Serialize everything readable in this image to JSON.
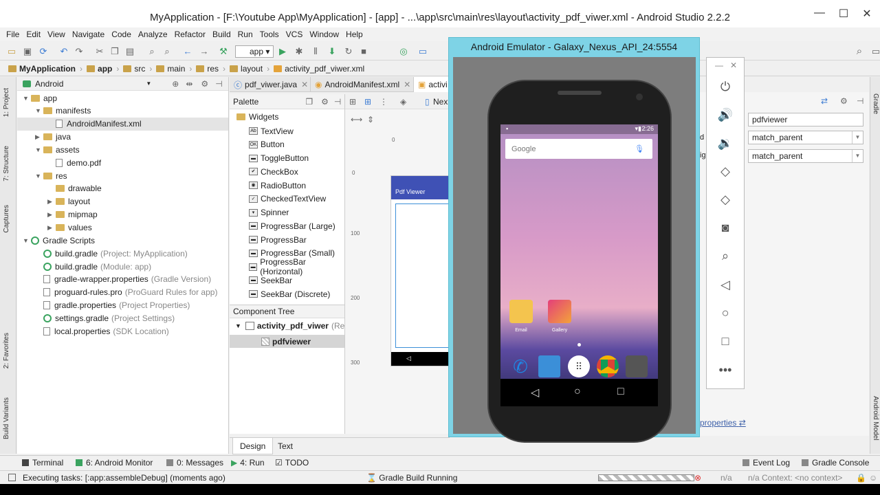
{
  "window": {
    "title": "MyApplication - [F:\\Youtube App\\MyApplication] - [app] - ...\\app\\src\\main\\res\\layout\\activity_pdf_viwer.xml - Android Studio 2.2.2",
    "min": "—",
    "max": "☐",
    "close": "✕"
  },
  "menu": [
    "File",
    "Edit",
    "View",
    "Navigate",
    "Code",
    "Analyze",
    "Refactor",
    "Build",
    "Run",
    "Tools",
    "VCS",
    "Window",
    "Help"
  ],
  "toolbar": {
    "run_config": "app"
  },
  "breadcrumbs": [
    "MyApplication",
    "app",
    "src",
    "main",
    "res",
    "layout",
    "activity_pdf_viwer.xml"
  ],
  "left_tabs": [
    "1: Project",
    "7: Structure",
    "Captures",
    "2: Favorites",
    "Build Variants"
  ],
  "project": {
    "view": "Android",
    "tree": [
      {
        "label": "app",
        "indent": 0,
        "type": "folder",
        "arrow": "▼"
      },
      {
        "label": "manifests",
        "indent": 1,
        "type": "folder",
        "arrow": "▼"
      },
      {
        "label": "AndroidManifest.xml",
        "indent": 2,
        "type": "file",
        "arrow": ""
      },
      {
        "label": "java",
        "indent": 1,
        "type": "folder",
        "arrow": "▶"
      },
      {
        "label": "assets",
        "indent": 1,
        "type": "folder",
        "arrow": "▼"
      },
      {
        "label": "demo.pdf",
        "indent": 2,
        "type": "file",
        "arrow": ""
      },
      {
        "label": "res",
        "indent": 1,
        "type": "folder",
        "arrow": "▼"
      },
      {
        "label": "drawable",
        "indent": 2,
        "type": "folder",
        "arrow": ""
      },
      {
        "label": "layout",
        "indent": 2,
        "type": "folder",
        "arrow": "▶"
      },
      {
        "label": "mipmap",
        "indent": 2,
        "type": "folder",
        "arrow": "▶"
      },
      {
        "label": "values",
        "indent": 2,
        "type": "folder",
        "arrow": "▶"
      },
      {
        "label": "Gradle Scripts",
        "indent": 0,
        "type": "gradle",
        "arrow": "▼"
      },
      {
        "label": "build.gradle",
        "note": "(Project: MyApplication)",
        "indent": 1,
        "type": "gradle",
        "arrow": ""
      },
      {
        "label": "build.gradle",
        "note": "(Module: app)",
        "indent": 1,
        "type": "gradle",
        "arrow": ""
      },
      {
        "label": "gradle-wrapper.properties",
        "note": "(Gradle Version)",
        "indent": 1,
        "type": "file",
        "arrow": ""
      },
      {
        "label": "proguard-rules.pro",
        "note": "(ProGuard Rules for app)",
        "indent": 1,
        "type": "file",
        "arrow": ""
      },
      {
        "label": "gradle.properties",
        "note": "(Project Properties)",
        "indent": 1,
        "type": "file",
        "arrow": ""
      },
      {
        "label": "settings.gradle",
        "note": "(Project Settings)",
        "indent": 1,
        "type": "gradle",
        "arrow": ""
      },
      {
        "label": "local.properties",
        "note": "(SDK Location)",
        "indent": 1,
        "type": "file",
        "arrow": ""
      }
    ]
  },
  "editor_tabs": [
    "pdf_viwer.java",
    "AndroidManifest.xml",
    "activi"
  ],
  "palette": {
    "title": "Palette",
    "group": "Widgets",
    "items": [
      "TextView",
      "Button",
      "ToggleButton",
      "CheckBox",
      "RadioButton",
      "CheckedTextView",
      "Spinner",
      "ProgressBar (Large)",
      "ProgressBar",
      "ProgressBar (Small)",
      "ProgressBar (Horizontal)",
      "SeekBar",
      "SeekBar (Discrete)"
    ],
    "component_tree_title": "Component Tree",
    "root": "activity_pdf_viwer",
    "root_note": "(Rela",
    "child": "pdfviewer"
  },
  "design": {
    "device": "Nex",
    "ruler": [
      "0",
      "0",
      "100",
      "200",
      "300"
    ],
    "preview_title": "Pdf Viewer"
  },
  "design_tabs": [
    "Design",
    "Text"
  ],
  "emulator": {
    "title": "Android Emulator - Galaxy_Nexus_API_24:5554",
    "time": "2:26",
    "search": "Google",
    "apps": [
      "Email",
      "Gallery"
    ]
  },
  "properties": {
    "id": "pdfviewer",
    "width": "match_parent",
    "height": "match_parent",
    "link": "properties",
    "clip": [
      "d",
      "ig"
    ]
  },
  "right_tabs": [
    "Gradle",
    "Android Model"
  ],
  "toolwindows": [
    "Terminal",
    "6: Android Monitor",
    "0: Messages",
    "4: Run",
    "TODO",
    "Event Log",
    "Gradle Console"
  ],
  "status": {
    "left": "Executing tasks: [:app:assembleDebug] (moments ago)",
    "center": "Gradle Build Running",
    "na1": "n/a",
    "na2": "n/a",
    "context": "Context: <no context>"
  }
}
